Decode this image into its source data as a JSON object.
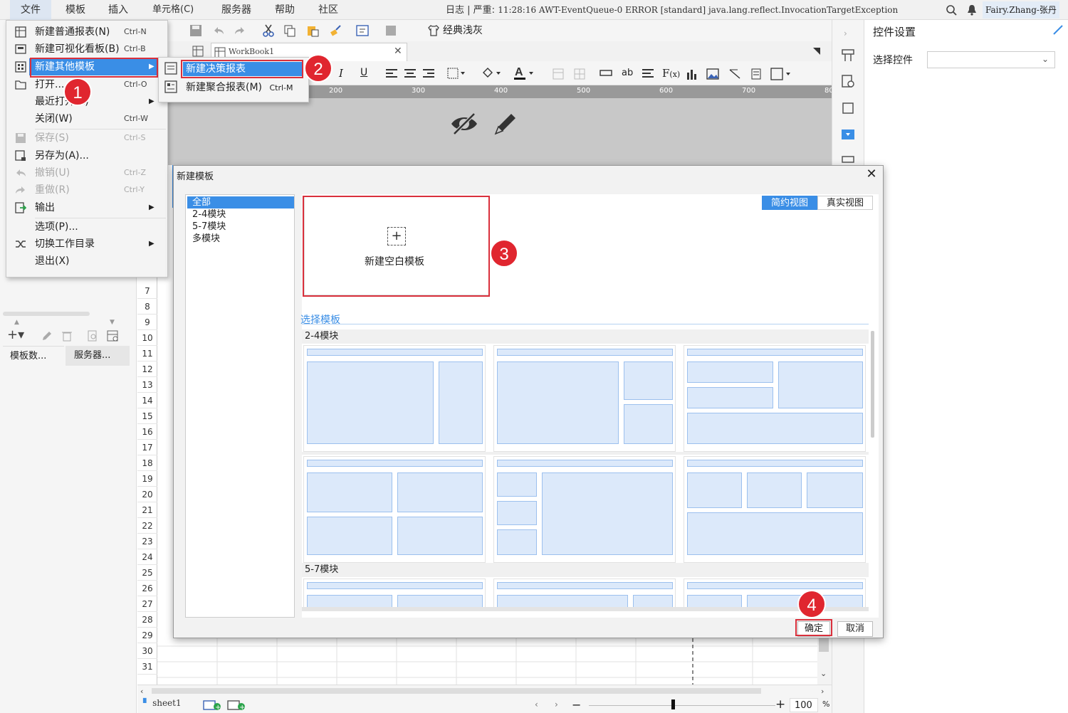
{
  "menubar": {
    "items": [
      "文件",
      "模板",
      "插入",
      "单元格(C)",
      "服务器",
      "帮助",
      "社区"
    ]
  },
  "status": {
    "log_label": "日志",
    "severity": "严重:",
    "message": "11:28:16 AWT-EventQueue-0 ERROR [standard] java.lang.reflect.InvocationTargetException",
    "user": "Fairy.Zhang-张丹"
  },
  "toolbar": {
    "theme_label": "经典浅灰"
  },
  "tabs": {
    "workbook": "WorkBook1"
  },
  "ruler": {
    "ticks": [
      "200",
      "300",
      "400",
      "500",
      "600",
      "700",
      "80"
    ]
  },
  "file_menu": {
    "items": [
      {
        "label": "新建普通报表(N)",
        "shortcut": "Ctrl-N"
      },
      {
        "label": "新建可视化看板(B)",
        "shortcut": "Ctrl-B"
      },
      {
        "label": "新建其他模板",
        "shortcut": ""
      },
      {
        "label": "打开...",
        "shortcut": "Ctrl-O"
      },
      {
        "label": "最近打开(E)",
        "shortcut": ""
      },
      {
        "label": "关闭(W)",
        "shortcut": "Ctrl-W"
      },
      {
        "label": "保存(S)",
        "shortcut": "Ctrl-S"
      },
      {
        "label": "另存为(A)...",
        "shortcut": ""
      },
      {
        "label": "撤销(U)",
        "shortcut": "Ctrl-Z"
      },
      {
        "label": "重做(R)",
        "shortcut": "Ctrl-Y"
      },
      {
        "label": "输出",
        "shortcut": ""
      },
      {
        "label": "选项(P)...",
        "shortcut": ""
      },
      {
        "label": "切换工作目录",
        "shortcut": ""
      },
      {
        "label": "退出(X)",
        "shortcut": ""
      }
    ]
  },
  "submenu": {
    "items": [
      {
        "label": "新建决策报表",
        "shortcut": ""
      },
      {
        "label": "新建聚合报表(M)",
        "shortcut": "Ctrl-M"
      }
    ]
  },
  "steps": [
    "1",
    "2",
    "3",
    "4"
  ],
  "left_panel": {
    "tabs": [
      "模板数...",
      "服务器..."
    ]
  },
  "rows": [
    "7",
    "8",
    "9",
    "10",
    "11",
    "12",
    "13",
    "14",
    "15",
    "16",
    "17",
    "18",
    "19",
    "20",
    "21",
    "22",
    "23",
    "24",
    "25",
    "26",
    "27",
    "28",
    "29",
    "30",
    "31"
  ],
  "right_panel": {
    "title": "控件设置",
    "select_label": "选择控件",
    "select_value": ""
  },
  "bottom": {
    "sheet": "sheet1",
    "zoom": "100",
    "zoom_unit": "%"
  },
  "dialog": {
    "title": "新建模板",
    "categories": [
      "全部",
      "2-4模块",
      "5-7模块",
      "多模块"
    ],
    "view_simple": "简约视图",
    "view_real": "真实视图",
    "blank_label": "新建空白模板",
    "section_label": "选择模板",
    "group1": "2-4模块",
    "group2": "5-7模块",
    "ok": "确定",
    "cancel": "取消"
  },
  "colors": {
    "highlight": "#3a8ee6",
    "accent_red": "#d9303c",
    "block_fill": "#dce9fa"
  }
}
